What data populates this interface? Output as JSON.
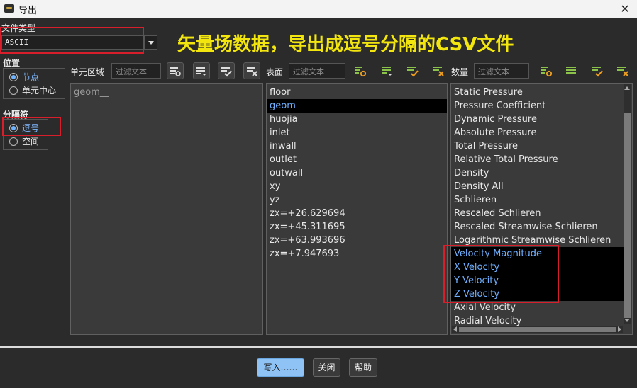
{
  "window": {
    "title": "导出",
    "close_glyph": "✕"
  },
  "file_type": {
    "label": "文件类型",
    "value": "ASCII"
  },
  "annotation": "矢量场数据，导出成逗号分隔的CSV文件",
  "location": {
    "label": "位置",
    "options": [
      {
        "label": "节点",
        "selected": true
      },
      {
        "label": "单元中心",
        "selected": false
      }
    ]
  },
  "delimiter": {
    "label": "分隔符",
    "options": [
      {
        "label": "逗号",
        "selected": true
      },
      {
        "label": "空间",
        "selected": false
      }
    ]
  },
  "cell_zones": {
    "label": "单元区域",
    "filter_placeholder": "过滤文本",
    "items": [
      "geom__"
    ]
  },
  "surfaces": {
    "label": "表面",
    "filter_placeholder": "过滤文本",
    "items": [
      "floor",
      "geom__",
      "huojia",
      "inlet",
      "inwall",
      "outlet",
      "outwall",
      "xy",
      "yz",
      "zx=+26.629694",
      "zx=+45.311695",
      "zx=+63.993696",
      "zx=+7.947693"
    ],
    "selected": [
      "geom__"
    ]
  },
  "quantities": {
    "label": "数量",
    "filter_placeholder": "过滤文本",
    "items": [
      "Static Pressure",
      "Pressure Coefficient",
      "Dynamic Pressure",
      "Absolute Pressure",
      "Total Pressure",
      "Relative Total Pressure",
      "Density",
      "Density All",
      "Schlieren",
      "Rescaled Schlieren",
      "Rescaled Streamwise Schlieren",
      "Logarithmic Streamwise Schlieren",
      "Velocity Magnitude",
      "X Velocity",
      "Y Velocity",
      "Z Velocity",
      "Axial Velocity",
      "Radial Velocity"
    ],
    "selected": [
      "Velocity Magnitude",
      "X Velocity",
      "Y Velocity",
      "Z Velocity"
    ]
  },
  "buttons": {
    "write": "写入……",
    "close": "关闭",
    "help": "帮助"
  },
  "colors": {
    "highlight_box": "#d81e2a",
    "annotation": "#f2e60e",
    "selection_text": "#6fb0ff",
    "primary_button": "#8fc3f5"
  }
}
